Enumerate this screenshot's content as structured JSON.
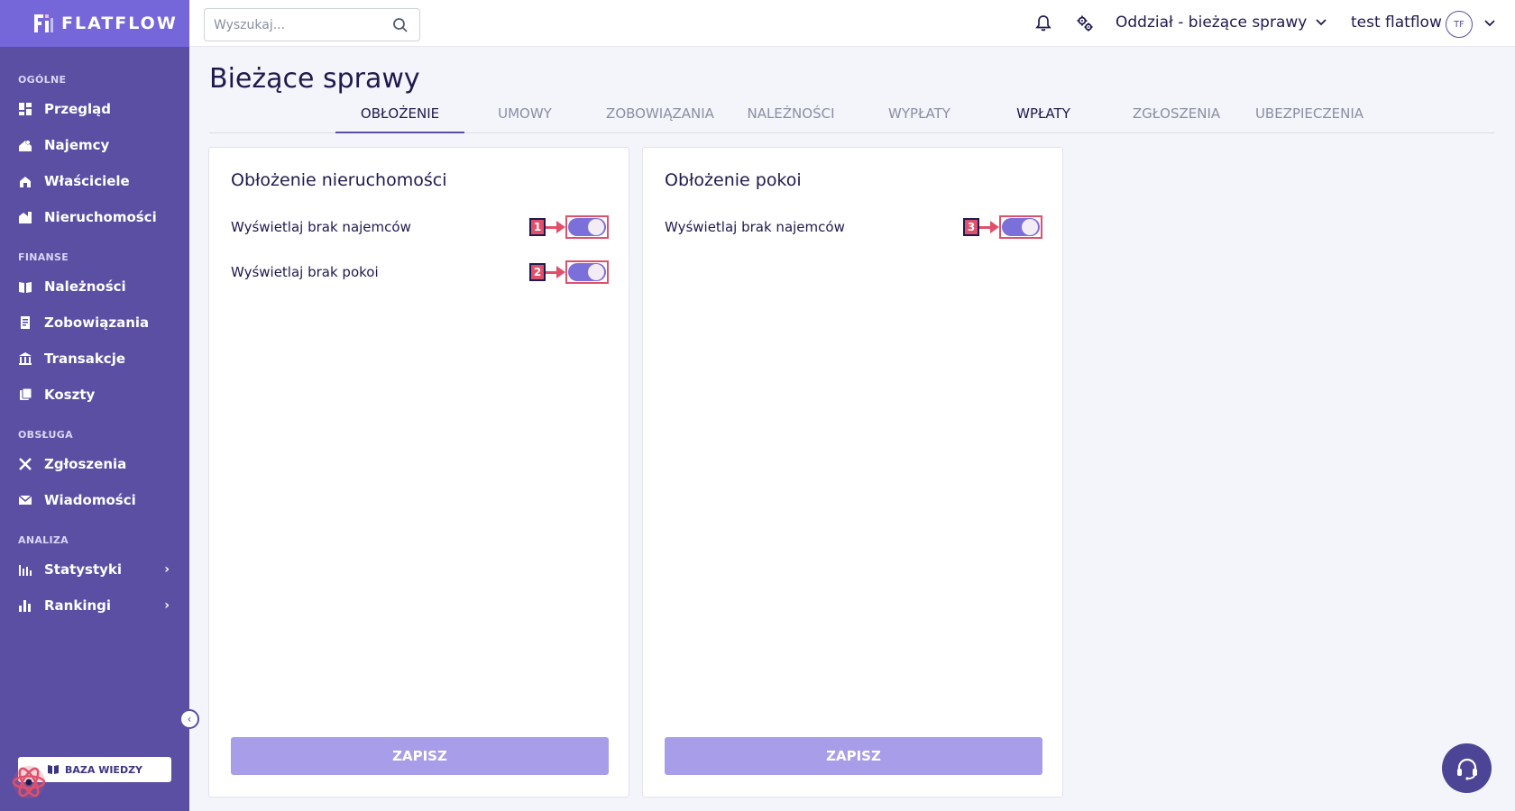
{
  "app": {
    "logo_text": "FLATFLOW"
  },
  "search": {
    "placeholder": "Wyszukaj..."
  },
  "header": {
    "branch": "Oddział - bieżące sprawy",
    "user": "test flatflow",
    "avatar_initials": "TF"
  },
  "sidebar": {
    "sections": [
      {
        "label": "OGÓLNE",
        "items": [
          {
            "label": "Przegląd",
            "icon": "dashboard-icon"
          },
          {
            "label": "Najemcy",
            "icon": "tenant-icon"
          },
          {
            "label": "Właściciele",
            "icon": "owners-icon"
          },
          {
            "label": "Nieruchomości",
            "icon": "property-icon"
          }
        ]
      },
      {
        "label": "FINANSE",
        "items": [
          {
            "label": "Należności",
            "icon": "receivables-icon"
          },
          {
            "label": "Zobowiązania",
            "icon": "liabilities-icon"
          },
          {
            "label": "Transakcje",
            "icon": "bank-icon"
          },
          {
            "label": "Koszty",
            "icon": "costs-icon"
          }
        ]
      },
      {
        "label": "OBSŁUGA",
        "items": [
          {
            "label": "Zgłoszenia",
            "icon": "tools-icon"
          },
          {
            "label": "Wiadomości",
            "icon": "mail-icon"
          }
        ]
      },
      {
        "label": "ANALIZA",
        "items": [
          {
            "label": "Statystyki",
            "icon": "stats-icon"
          },
          {
            "label": "Rankingi",
            "icon": "ranking-icon"
          }
        ]
      }
    ],
    "knowledge_base": "BAZA WIEDZY"
  },
  "page": {
    "title": "Bieżące sprawy"
  },
  "tabs": [
    "OBŁOŻENIE",
    "UMOWY",
    "ZOBOWIĄZANIA",
    "NALEŻNOŚCI",
    "WYPŁATY",
    "WPŁATY",
    "ZGŁOSZENIA",
    "UBEZPIECZENIA"
  ],
  "cards": {
    "property": {
      "title": "Obłożenie nieruchomości",
      "rows": [
        {
          "label": "Wyświetlaj brak najemców",
          "marker": "1",
          "on": true
        },
        {
          "label": "Wyświetlaj brak pokoi",
          "marker": "2",
          "on": true
        }
      ],
      "save": "ZAPISZ"
    },
    "rooms": {
      "title": "Obłożenie pokoi",
      "rows": [
        {
          "label": "Wyświetlaj brak najemców",
          "marker": "3",
          "on": true
        }
      ],
      "save": "ZAPISZ"
    }
  },
  "colors": {
    "sidebar": "#5a4fa3",
    "logo_bg": "#7566d9",
    "accent": "#7b6fd9",
    "button": "#a89de8",
    "marker": "#e0506a"
  }
}
